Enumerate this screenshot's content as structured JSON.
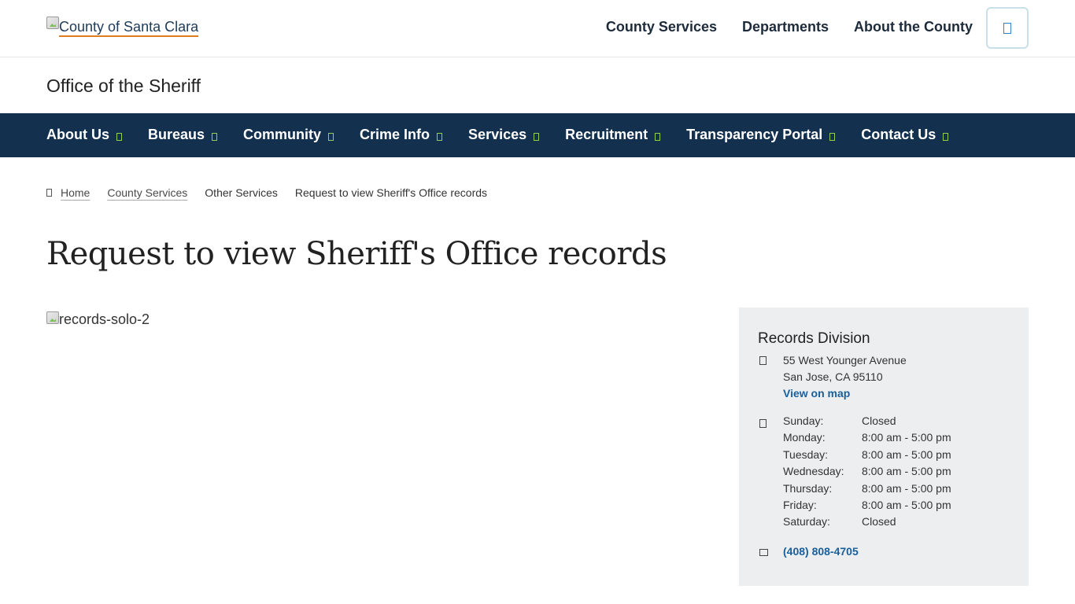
{
  "header": {
    "logo_alt": "County of Santa Clara",
    "nav": [
      "County Services",
      "Departments",
      "About the County"
    ],
    "search_icon": "search-icon"
  },
  "office_title": "Office of the Sheriff",
  "main_nav": [
    {
      "label": "About Us"
    },
    {
      "label": "Bureaus"
    },
    {
      "label": "Community"
    },
    {
      "label": "Crime Info"
    },
    {
      "label": "Services"
    },
    {
      "label": "Recruitment"
    },
    {
      "label": "Transparency Portal"
    },
    {
      "label": "Contact Us"
    }
  ],
  "breadcrumb": {
    "home": "Home",
    "items": [
      "County Services",
      "Other Services",
      "Request to view Sheriff's Office records"
    ]
  },
  "page_title": "Request to view Sheriff's Office records",
  "image_alt": "records-solo-2",
  "sidebar": {
    "title": "Records Division",
    "address_line1": "55 West Younger Avenue",
    "address_line2": "San Jose, CA 95110",
    "map_link": "View on map",
    "hours": [
      {
        "day": "Sunday:",
        "time": "Closed"
      },
      {
        "day": "Monday:",
        "time": "8:00 am - 5:00 pm"
      },
      {
        "day": "Tuesday:",
        "time": "8:00 am - 5:00 pm"
      },
      {
        "day": "Wednesday:",
        "time": "8:00 am - 5:00 pm"
      },
      {
        "day": "Thursday:",
        "time": "8:00 am - 5:00 pm"
      },
      {
        "day": "Friday:",
        "time": "8:00 am - 5:00 pm"
      },
      {
        "day": "Saturday:",
        "time": "Closed"
      }
    ],
    "phone": "(408) 808-4705"
  },
  "colors": {
    "nav_bg": "#14304f",
    "link": "#1a5f9a",
    "caret": "#8fd14f",
    "card_bg": "#eceef0",
    "logo_underline": "#e07c1f"
  }
}
